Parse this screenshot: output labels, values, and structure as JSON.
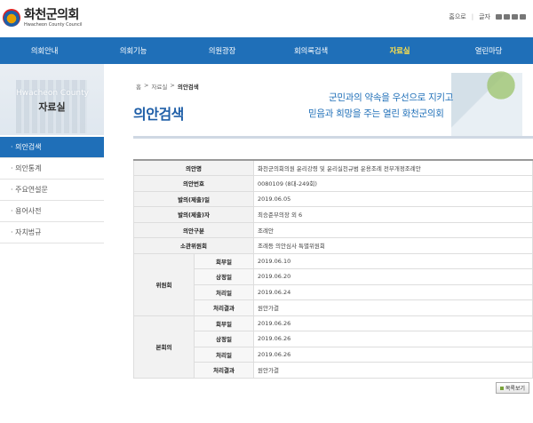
{
  "header": {
    "logo_kr": "화천군의회",
    "logo_en": "Hwacheon County Council",
    "util_home": "홈으로",
    "util_size": "글자"
  },
  "nav": [
    "의회안내",
    "의회기능",
    "의원광장",
    "회의록검색",
    "자료실",
    "열린마당"
  ],
  "sidebar": {
    "watermark": "Hwacheon County",
    "title": "자료실",
    "items": [
      "· 의안검색",
      "· 의안통계",
      "· 주요연설문",
      "· 용어사전",
      "· 자치법규"
    ]
  },
  "breadcrumb": [
    "홈",
    ">",
    "자료실",
    ">",
    "의안검색"
  ],
  "page_title": "의안검색",
  "banner": {
    "line1": "군민과의 약속을 우선으로 지키고",
    "line2": "믿음과 희망을 주는 열린 화천군의회"
  },
  "table": {
    "rows": [
      {
        "label": "의안명",
        "value": "화천군의회의원 윤리강령 및 윤리실천규범 운용조례 전부개정조례안"
      },
      {
        "label": "의안번호",
        "value": "0080109 (8대-249회)"
      },
      {
        "label": "발의(제출)일",
        "value": "2019.06.05"
      },
      {
        "label": "발의(제출)자",
        "value": "최승준부의장 외 6"
      },
      {
        "label": "의안구분",
        "value": "조례안"
      },
      {
        "label": "소관위원회",
        "value": "조례등 의안심사 특별위원회"
      }
    ],
    "committee": {
      "group": "위원회",
      "rows": [
        {
          "label": "회부일",
          "value": "2019.06.10"
        },
        {
          "label": "상정일",
          "value": "2019.06.20"
        },
        {
          "label": "처리일",
          "value": "2019.06.24"
        },
        {
          "label": "처리결과",
          "value": "원안가결"
        }
      ]
    },
    "plenary": {
      "group": "본회의",
      "rows": [
        {
          "label": "회부일",
          "value": "2019.06.26"
        },
        {
          "label": "상정일",
          "value": "2019.06.26"
        },
        {
          "label": "처리일",
          "value": "2019.06.26"
        },
        {
          "label": "처리결과",
          "value": "원안가결"
        }
      ]
    }
  },
  "list_button": "목록보기"
}
